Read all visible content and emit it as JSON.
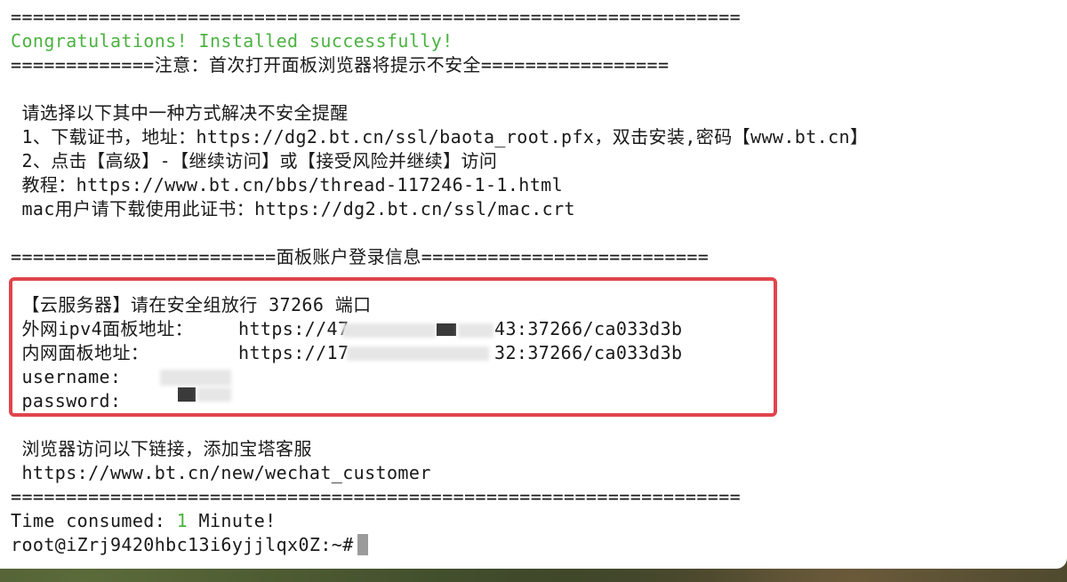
{
  "lines": {
    "l0": "==================================================================",
    "congrats": "Congratulations! Installed successfully!",
    "warning": "=============注意：首次打开面板浏览器将提示不安全=================",
    "instr": " 请选择以下其中一种方式解决不安全提醒",
    "step1": " 1、下载证书，地址：https://dg2.bt.cn/ssl/baota_root.pfx，双击安装,密码【www.bt.cn】",
    "step2": " 2、点击【高级】-【继续访问】或【接受风险并继续】访问",
    "tutorial": " 教程：https://www.bt.cn/bbs/thread-117246-1-1.html",
    "mac": " mac用户请下载使用此证书：https://dg2.bt.cn/ssl/mac.crt",
    "info_header": "========================面板账户登录信息==========================",
    "cloud": " 【云服务器】请在安全组放行 37266 端口",
    "ext_label": " 外网ipv4面板地址：",
    "ext_url_a": "https://47",
    "ext_url_b": "43:37266/ca033d3b",
    "int_label": " 内网面板地址：",
    "int_url_a": "https://17",
    "int_url_b": "32:37266/ca033d3b",
    "username": " username:",
    "password": " password:",
    "browser": " 浏览器访问以下链接，添加宝塔客服",
    "wechat": " https://www.bt.cn/new/wechat_customer",
    "l_sep": "==================================================================",
    "time_prefix": "Time consumed: ",
    "time_value": "1",
    "time_suffix": " Minute!",
    "prompt": "root@iZrj9420hbc13i6yjjlqx0Z:~#"
  },
  "colors": {
    "success": "#4cb341",
    "box": "#e0454d"
  }
}
